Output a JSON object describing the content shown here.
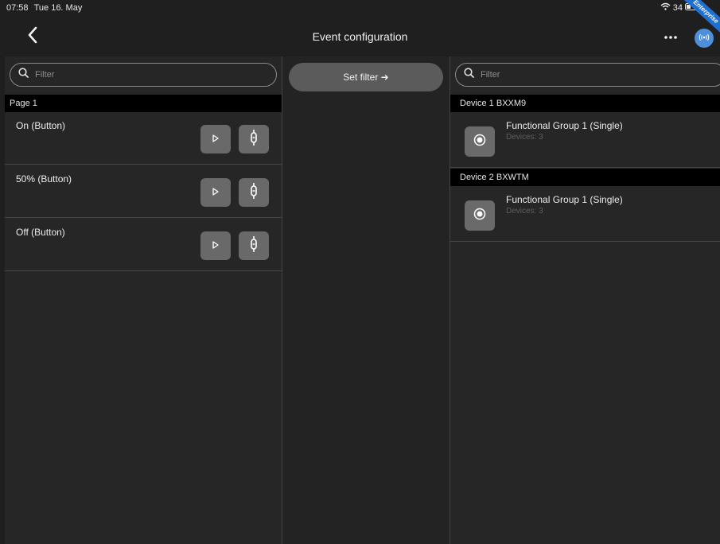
{
  "status_bar": {
    "time": "07:58",
    "date": "Tue 16. May",
    "battery": "34",
    "banner": "Enterprise"
  },
  "nav": {
    "title": "Event configuration",
    "back_icon": "chevron-left-icon",
    "more_icon": "more-horizontal-icon",
    "signal_icon": "broadcast-icon",
    "signal_color": "#4d8fd9"
  },
  "left_panel": {
    "filter_placeholder": "Filter",
    "section": "Page 1",
    "events": [
      {
        "label": "On (Button)"
      },
      {
        "label": "50% (Button)"
      },
      {
        "label": "Off (Button)"
      }
    ]
  },
  "middle_panel": {
    "set_filter_label": "Set filter ➜"
  },
  "right_panel": {
    "filter_placeholder": "Filter",
    "devices": [
      {
        "header": "Device 1 BXXM9",
        "group_title": "Functional Group 1 (Single)",
        "group_sub": "Devices: 3"
      },
      {
        "header": "Device 2 BXWTM",
        "group_title": "Functional Group 1 (Single)",
        "group_sub": "Devices: 3"
      }
    ]
  },
  "colors": {
    "background": "#1f1f1f",
    "panel": "#262626",
    "header_bar": "#000000",
    "button_gray": "#696969"
  }
}
